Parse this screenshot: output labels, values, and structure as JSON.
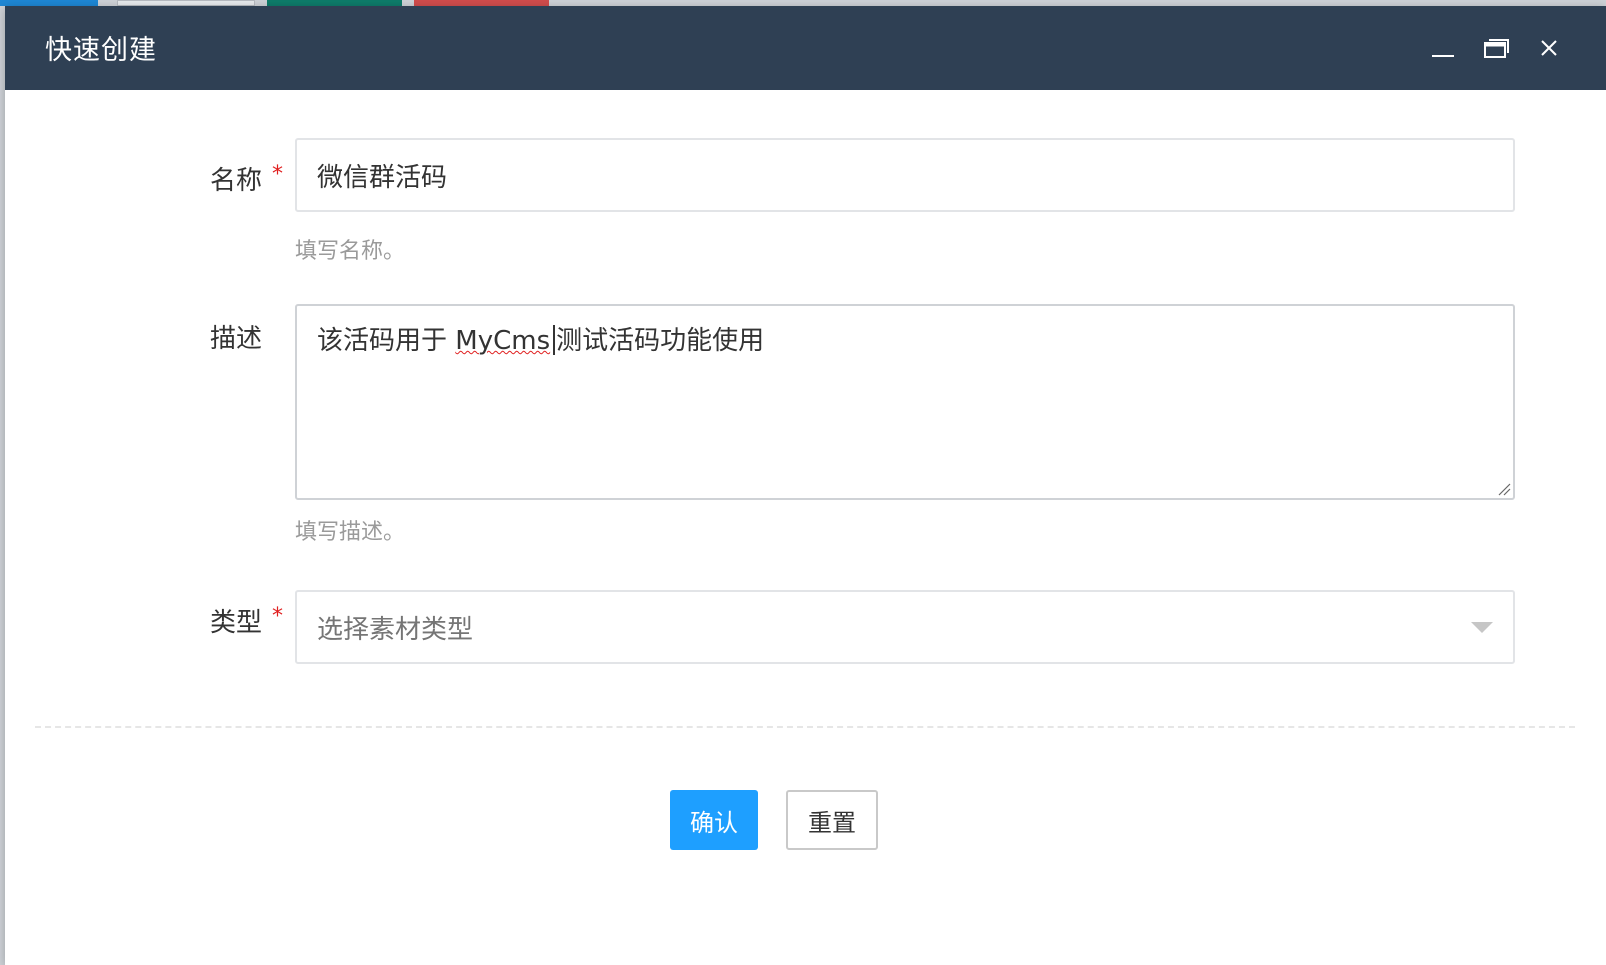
{
  "modal": {
    "title": "快速创建"
  },
  "form": {
    "name": {
      "label": "名称",
      "required_mark": "*",
      "value": "微信群活码",
      "help": "填写名称。"
    },
    "description": {
      "label": "描述",
      "value_before": "该活码用于 ",
      "value_misspelled": "MyCms",
      "value_after": "测试活码功能使用",
      "help": "填写描述。"
    },
    "type": {
      "label": "类型",
      "required_mark": "*",
      "placeholder": "选择素材类型"
    }
  },
  "buttons": {
    "confirm": "确认",
    "reset": "重置"
  },
  "colors": {
    "header_bg": "#2f4054",
    "primary": "#1e9fff",
    "required": "#e02020"
  },
  "icons": {
    "minimize": "minimize-icon",
    "maximize": "maximize-icon",
    "close": "close-icon",
    "select_arrow": "chevron-down-icon"
  }
}
